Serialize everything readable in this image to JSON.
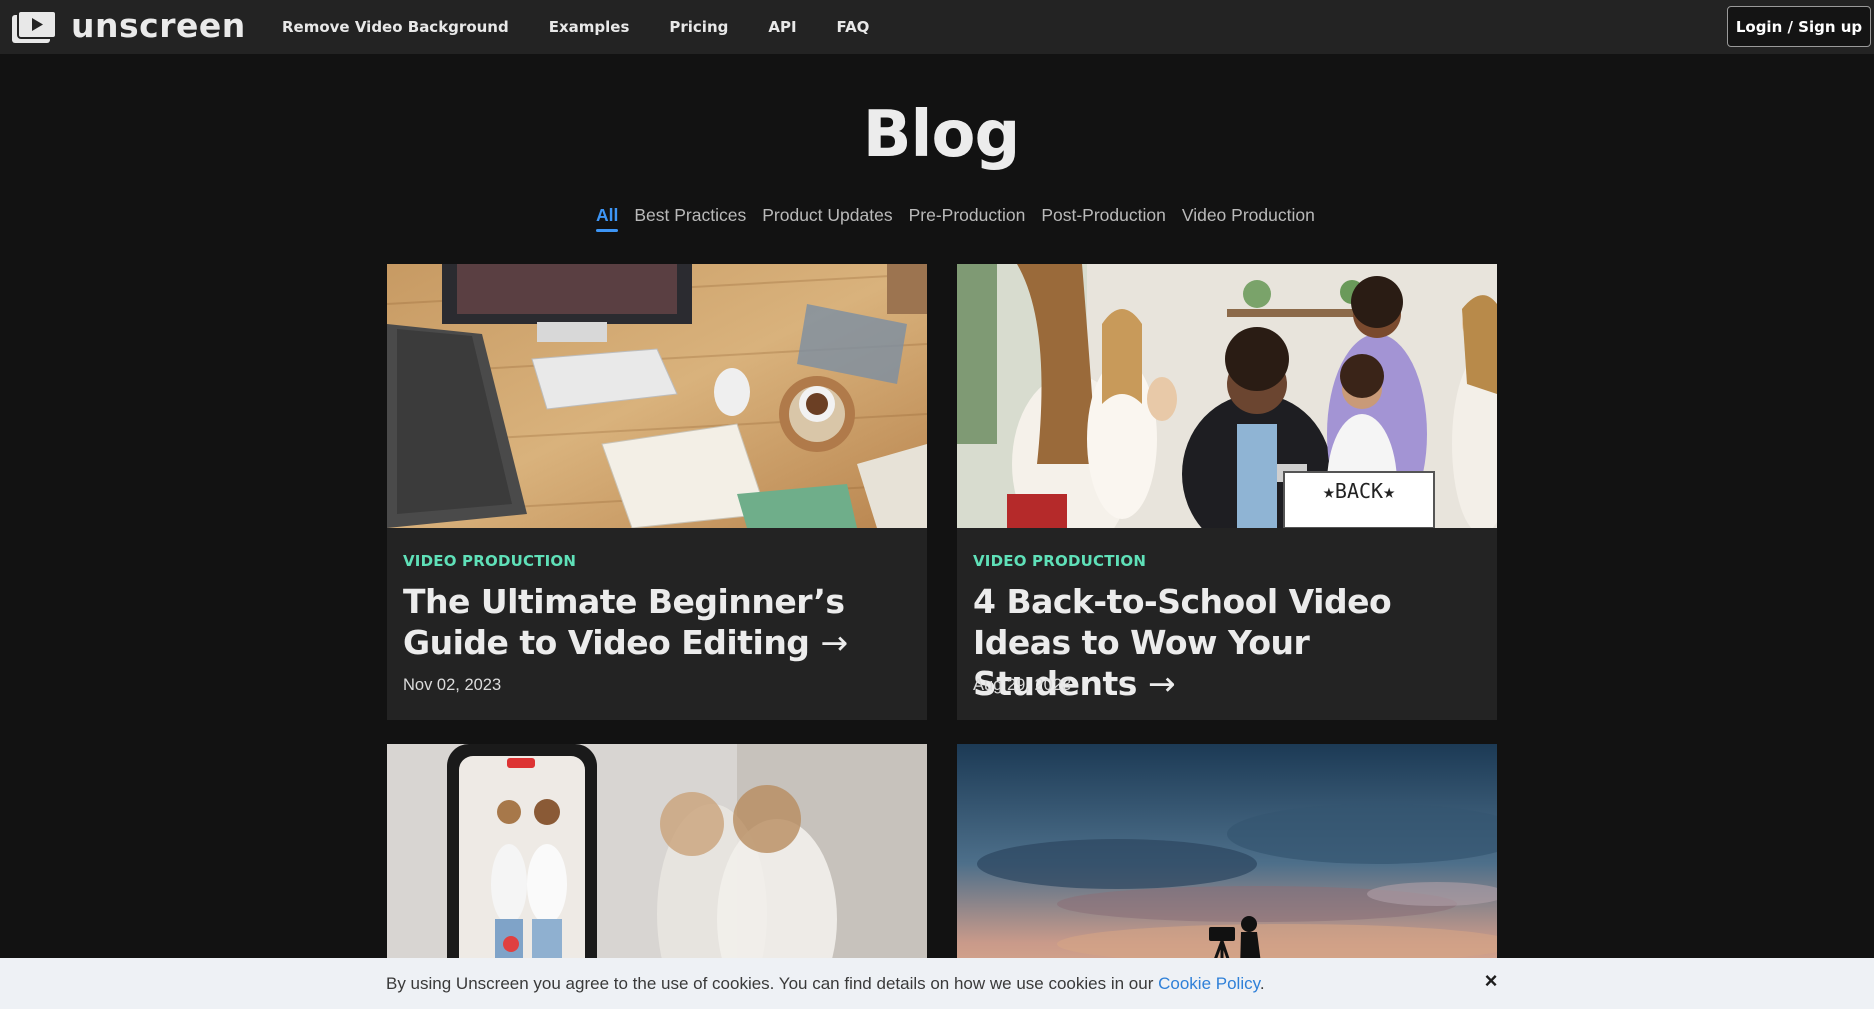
{
  "header": {
    "brand": "unscreen",
    "nav": [
      "Remove Video Background",
      "Examples",
      "Pricing",
      "API",
      "FAQ"
    ],
    "login_label": "Login / Sign up"
  },
  "page": {
    "title": "Blog",
    "filters": [
      {
        "label": "All",
        "active": true
      },
      {
        "label": "Best Practices",
        "active": false
      },
      {
        "label": "Product Updates",
        "active": false
      },
      {
        "label": "Pre-Production",
        "active": false
      },
      {
        "label": "Post-Production",
        "active": false
      },
      {
        "label": "Video Production",
        "active": false
      }
    ]
  },
  "posts": [
    {
      "category": "VIDEO PRODUCTION",
      "title": "The Ultimate Beginner’s Guide to Video Editing",
      "arrow": "→",
      "date": "Nov 02, 2023",
      "image_alt": "desk-with-computer-and-notebook-image"
    },
    {
      "category": "VIDEO PRODUCTION",
      "title": "4 Back-to-School Video Ideas to Wow Your Students",
      "arrow": "→",
      "date": "Aug 29, 2023",
      "image_alt": "classroom-students-image",
      "sign_text": "★BACK★"
    },
    {
      "image_alt": "phone-recording-dancers-image"
    },
    {
      "image_alt": "camera-operator-silhouette-at-sunset-image"
    }
  ],
  "cookie": {
    "text": "By using Unscreen you agree to the use of cookies. You can find details on how we use cookies in our",
    "link": "Cookie Policy",
    "period": ".",
    "close": "×"
  },
  "colors": {
    "background": "#121212",
    "header": "#232323",
    "card": "#232323",
    "accent_blue": "#3d95f5",
    "category_green": "#5fe0b8",
    "cookie_bg": "#eef1f5"
  }
}
